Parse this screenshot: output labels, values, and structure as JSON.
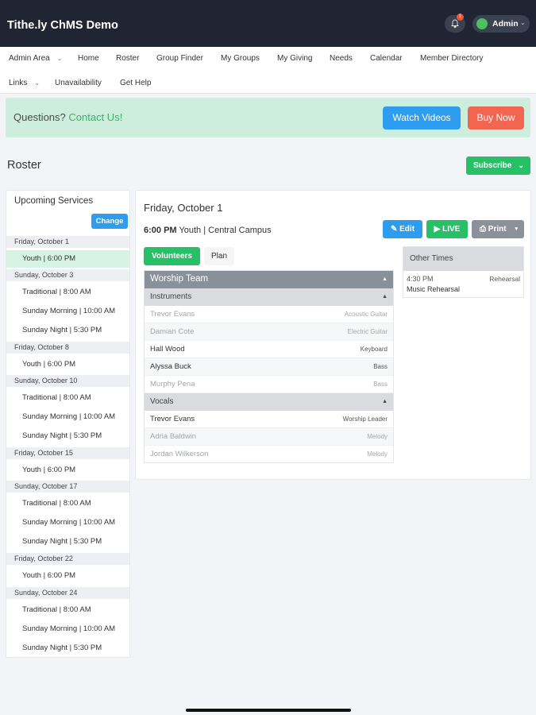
{
  "app": {
    "title": "Tithe.ly ChMS Demo",
    "notification_count": "1",
    "user_label": "Admin"
  },
  "nav": {
    "row1": [
      "Admin Area",
      "Home",
      "Roster",
      "Group Finder",
      "My Groups",
      "My Giving",
      "Needs",
      "Calendar",
      "Member Directory"
    ],
    "row2": [
      "Links",
      "Unavailability",
      "Get Help"
    ]
  },
  "banner": {
    "question": "Questions?",
    "link": "Contact Us!",
    "watch_label": "Watch Videos",
    "buy_label": "Buy Now"
  },
  "page": {
    "title": "Roster",
    "subscribe_label": "Subscribe"
  },
  "services": {
    "title": "Upcoming Services",
    "change_label": "Change",
    "days": [
      {
        "day": "Friday, October 1",
        "items": [
          "Youth | 6:00 PM"
        ]
      },
      {
        "day": "Sunday, October 3",
        "items": [
          "Traditional | 8:00 AM",
          "Sunday Morning | 10:00 AM",
          "Sunday Night | 5:30 PM"
        ]
      },
      {
        "day": "Friday, October 8",
        "items": [
          "Youth | 6:00 PM"
        ]
      },
      {
        "day": "Sunday, October 10",
        "items": [
          "Traditional | 8:00 AM",
          "Sunday Morning | 10:00 AM",
          "Sunday Night | 5:30 PM"
        ]
      },
      {
        "day": "Friday, October 15",
        "items": [
          "Youth | 6:00 PM"
        ]
      },
      {
        "day": "Sunday, October 17",
        "items": [
          "Traditional | 8:00 AM",
          "Sunday Morning | 10:00 AM",
          "Sunday Night | 5:30 PM"
        ]
      },
      {
        "day": "Friday, October 22",
        "items": [
          "Youth | 6:00 PM"
        ]
      },
      {
        "day": "Sunday, October 24",
        "items": [
          "Traditional | 8:00 AM",
          "Sunday Morning | 10:00 AM",
          "Sunday Night | 5:30 PM"
        ]
      }
    ]
  },
  "main": {
    "date": "Friday, October 1",
    "time": "6:00 PM",
    "service": "Youth | Central Campus",
    "edit_label": "Edit",
    "live_label": "LIVE",
    "print_label": "Print",
    "tab_volunteers": "Volunteers",
    "tab_plan": "Plan",
    "team": "Worship Team",
    "instruments": {
      "label": "Instruments",
      "rows": [
        {
          "name": "Trevor Evans",
          "role": "Acoustic Guitar"
        },
        {
          "name": "Damian Cote",
          "role": "Electric Guitar"
        },
        {
          "name": "Hall Wood",
          "role": "Keyboard"
        },
        {
          "name": "Alyssa Buck",
          "role": "Bass"
        },
        {
          "name": "Murphy Pena",
          "role": "Bass"
        }
      ]
    },
    "vocals": {
      "label": "Vocals",
      "rows": [
        {
          "name": "Trevor Evans",
          "role": "Worship Leader"
        },
        {
          "name": "Adria Baldwin",
          "role": "Melody"
        },
        {
          "name": "Jordan Wilkerson",
          "role": "Melody"
        }
      ]
    },
    "other_times": {
      "title": "Other Times",
      "time": "4:30 PM",
      "type": "Rehearsal",
      "name": "Music Rehearsal"
    }
  }
}
